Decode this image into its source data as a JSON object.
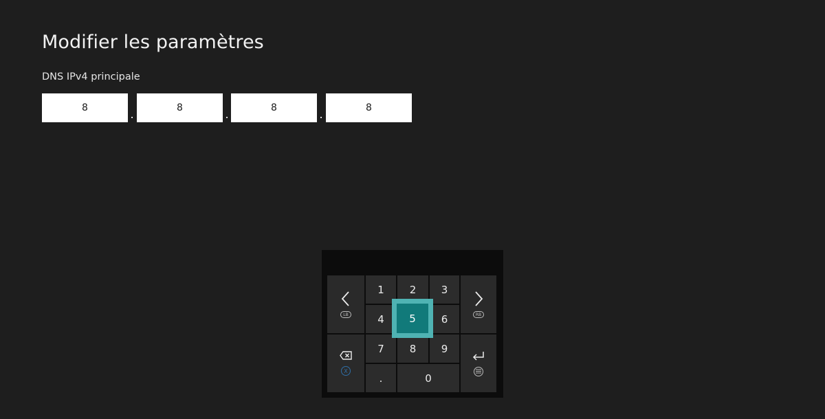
{
  "header": {
    "title": "Modifier les paramètres"
  },
  "dns_field": {
    "label": "DNS IPv4 principale",
    "octets": [
      "8",
      "8",
      "8",
      "8"
    ],
    "separator": "."
  },
  "keypad": {
    "digits": [
      "1",
      "2",
      "3",
      "4",
      "5",
      "6",
      "7",
      "8",
      "9",
      "0"
    ],
    "decimal_key": ".",
    "focused_key": "5",
    "left_badge": "LB",
    "right_badge": "RB",
    "backspace_badge": "X",
    "focus_color": "#117a7a",
    "focus_ring_color": "#4fb3b3",
    "x_button_color": "#2f6fa8"
  }
}
